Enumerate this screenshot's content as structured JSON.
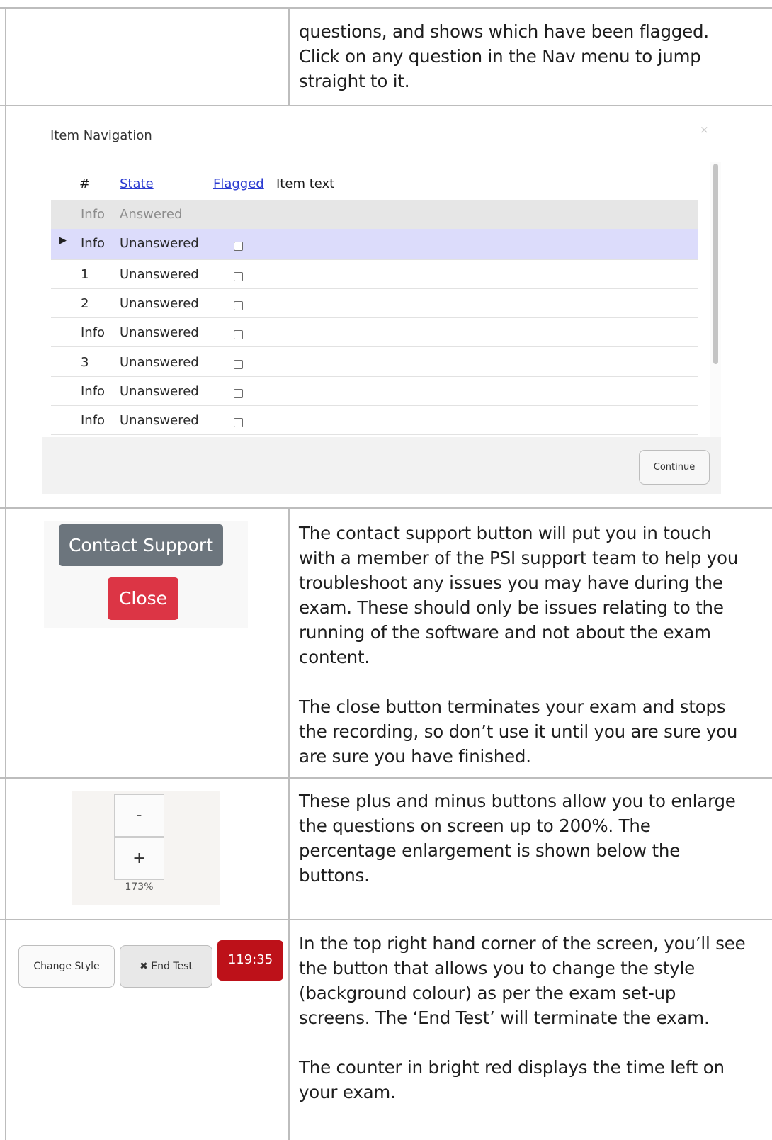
{
  "rows": {
    "nav_text": "questions, and shows which have been flagged. Click on any question in the Nav menu to jump straight to it.",
    "support_text_1": "The contact support button will put you in touch with a member of the PSI support team to help you troubleshoot any issues you may have during the exam. These should only be issues relating to the running of the software and not about the exam content.",
    "support_text_2": "The close button terminates your exam and stops the recording, so don’t use it until you are sure you are sure you have finished.",
    "zoom_text": "These plus and minus buttons allow you to enlarge the questions on screen up to 200%. The percentage enlargement is shown below the buttons.",
    "toolbar_text_1": "In the top right hand corner of the screen, you’ll see the button that allows you to change the style (background colour) as per the exam set-up screens. The ‘End Test’ will terminate the exam.",
    "toolbar_text_2": "The counter in bright red displays the time left on your exam."
  },
  "item_navigation": {
    "title": "Item Navigation",
    "close_glyph": "×",
    "columns": {
      "num": "#",
      "state": "State",
      "flagged": "Flagged",
      "item_text": "Item text"
    },
    "rows": [
      {
        "num": "Info",
        "state": "Answered",
        "answered": true,
        "current": false
      },
      {
        "num": "Info",
        "state": "Unanswered",
        "answered": false,
        "current": true
      },
      {
        "num": "1",
        "state": "Unanswered",
        "answered": false,
        "current": false
      },
      {
        "num": "2",
        "state": "Unanswered",
        "answered": false,
        "current": false
      },
      {
        "num": "Info",
        "state": "Unanswered",
        "answered": false,
        "current": false
      },
      {
        "num": "3",
        "state": "Unanswered",
        "answered": false,
        "current": false
      },
      {
        "num": "Info",
        "state": "Unanswered",
        "answered": false,
        "current": false
      },
      {
        "num": "Info",
        "state": "Unanswered",
        "answered": false,
        "current": false
      }
    ],
    "continue_label": "Continue"
  },
  "support_panel": {
    "contact_label": "Contact Support",
    "close_label": "Close"
  },
  "zoom_panel": {
    "minus_label": "-",
    "plus_label": "+",
    "zoom_level": "173%"
  },
  "toolbar_panel": {
    "change_style_label": "Change Style",
    "end_test_label": "End Test",
    "end_test_icon": "✖",
    "timer": "119:35"
  },
  "colors": {
    "contact_support": "#6c757d",
    "close": "#dc3545",
    "timer": "#bd1119",
    "link": "#2b3bd1",
    "current_row": "#dcdcfb"
  }
}
